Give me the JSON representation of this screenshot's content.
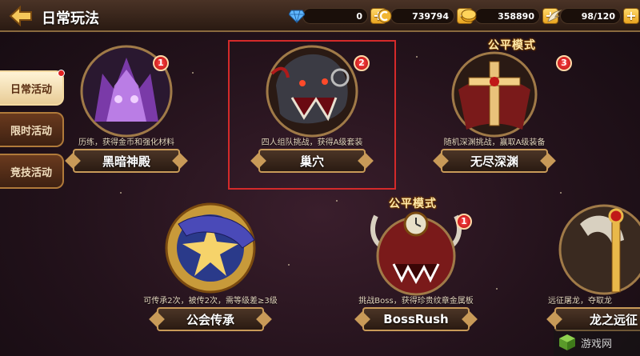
{
  "header": {
    "title": "日常玩法",
    "currencies": [
      {
        "name": "diamond",
        "icon": "diamond-icon",
        "amount": "0"
      },
      {
        "name": "coupon",
        "icon": "coupon-icon",
        "amount": "739794"
      },
      {
        "name": "gold",
        "icon": "gold-coin-icon",
        "amount": "358890"
      },
      {
        "name": "stamina",
        "icon": "wing-icon",
        "amount": "98/120"
      }
    ],
    "plus_label": "+"
  },
  "sidebar": {
    "tabs": [
      {
        "label": "日常活动",
        "active": true,
        "has_dot": true
      },
      {
        "label": "限时活动",
        "active": false
      },
      {
        "label": "竞技活动",
        "active": false
      }
    ]
  },
  "activities": [
    {
      "name": "黑暗神殿",
      "desc": "历练，获得金币和强化材料",
      "badge": "1"
    },
    {
      "name": "巢穴",
      "desc": "四人组队挑战，获得A级套装",
      "badge": "2",
      "selected": true
    },
    {
      "name": "无尽深渊",
      "desc": "随机深渊挑战，赢取A级装备",
      "badge": "3",
      "tag": "公平模式"
    },
    {
      "name": "公会传承",
      "desc": "可传承2次，被传2次，需等级差≥3级"
    },
    {
      "name": "BossRush",
      "desc": "挑战Boss，获得珍贵纹章金属板",
      "badge": "1",
      "tag": "公平模式"
    },
    {
      "name": "龙之远征",
      "desc": "远征屠龙，夺取龙"
    }
  ],
  "watermark": "游戏网"
}
